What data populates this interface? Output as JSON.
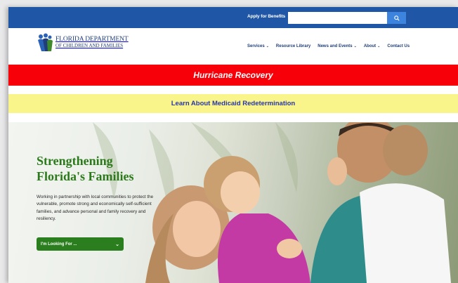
{
  "utility_bar": {
    "apply_link": "Apply for Benefits",
    "search": {
      "value": "",
      "placeholder": "",
      "button_icon": "search-icon"
    }
  },
  "header": {
    "logo": {
      "line1": "FLORIDA DEPARTMENT",
      "line2": "OF CHILDREN AND FAMILIES",
      "icon": "dcf-family-logo"
    },
    "nav": [
      {
        "label": "Services",
        "has_dropdown": true
      },
      {
        "label": "Resource Library",
        "has_dropdown": false
      },
      {
        "label": "News and Events",
        "has_dropdown": true
      },
      {
        "label": "About",
        "has_dropdown": true
      },
      {
        "label": "Contact Us",
        "has_dropdown": false
      }
    ]
  },
  "banners": {
    "hurricane": "Hurricane Recovery",
    "medicaid": "Learn About Medicaid Redetermination"
  },
  "hero": {
    "title_line1": "Strengthening",
    "title_line2": "Florida's Families",
    "body": "Working in partnership with local communities to protect the vulnerable, promote strong and economically self-sufficient families, and advance personal and family recovery and resiliency.",
    "dropdown_label": "I'm Looking For ..."
  },
  "colors": {
    "utility_bar": "#1f56a6",
    "hurricane_banner": "#f80009",
    "medicaid_banner": "#faf58a",
    "brand_navy": "#1f3e7a",
    "hero_green": "#2b7a1a",
    "button_green": "#2a7e1d"
  }
}
